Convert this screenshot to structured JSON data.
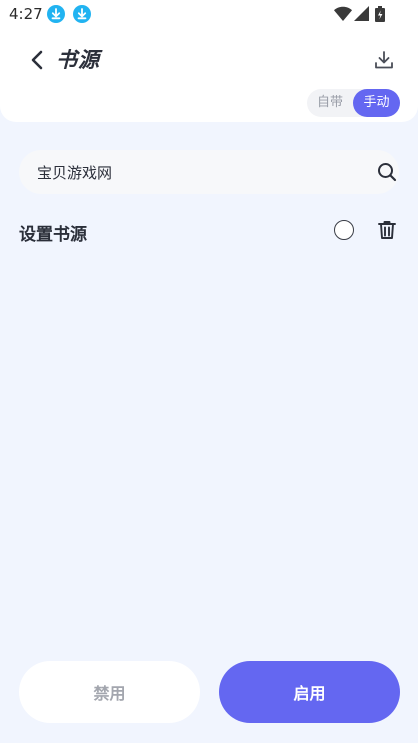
{
  "status_bar": {
    "time": "4:27"
  },
  "header": {
    "title": "书源"
  },
  "toggle": {
    "builtin_label": "自带",
    "manual_label": "手动",
    "selected": "manual"
  },
  "search": {
    "value": "宝贝游戏网"
  },
  "source": {
    "title": "设置书源",
    "selected": false
  },
  "footer": {
    "disable_label": "禁用",
    "enable_label": "启用"
  },
  "colors": {
    "accent": "#6467f1",
    "download_badge": "#21b3f1",
    "background": "#f1f5fe"
  }
}
